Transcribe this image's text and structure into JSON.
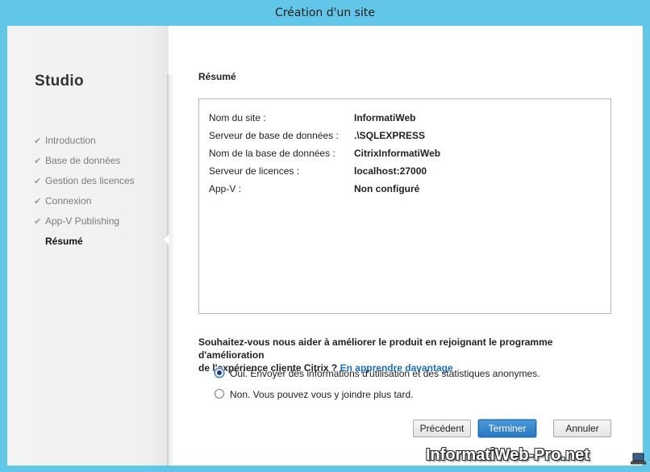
{
  "window": {
    "title": "Création d'un site"
  },
  "sidebar": {
    "title": "Studio",
    "steps": [
      {
        "label": "Introduction",
        "done": true
      },
      {
        "label": "Base de données",
        "done": true
      },
      {
        "label": "Gestion des licences",
        "done": true
      },
      {
        "label": "Connexion",
        "done": true
      },
      {
        "label": "App-V Publishing",
        "done": true
      },
      {
        "label": "Résumé",
        "active": true
      }
    ]
  },
  "main": {
    "section_title": "Résumé",
    "summary": [
      {
        "key": "Nom du site :",
        "value": "InformatiWeb"
      },
      {
        "key": "Serveur de base de données :",
        "value": ".\\SQLEXPRESS"
      },
      {
        "key": "Nom de la base de données :",
        "value": "CitrixInformatiWeb"
      },
      {
        "key": "Serveur de licences :",
        "value": "localhost:27000"
      },
      {
        "key": "App-V :",
        "value": "Non configuré"
      }
    ],
    "question_line1": "Souhaitez-vous nous aider à améliorer le produit en rejoignant le programme d'amélioration",
    "question_line2": "de l'expérience cliente Citrix ?",
    "learn_more_link": "En apprendre davantage",
    "options": [
      {
        "label": "Oui. Envoyer des informations d'utilisation et des statistiques anonymes.",
        "selected": true
      },
      {
        "label": "Non. Vous pouvez vous y joindre plus tard.",
        "selected": false
      }
    ]
  },
  "buttons": {
    "previous": "Précédent",
    "finish": "Terminer",
    "cancel": "Annuler"
  },
  "watermark": "InformatiWeb-Pro.net",
  "colors": {
    "titlebar": "#62c6e8",
    "primary_button": "#2878c2",
    "link": "#1d6fb8"
  }
}
